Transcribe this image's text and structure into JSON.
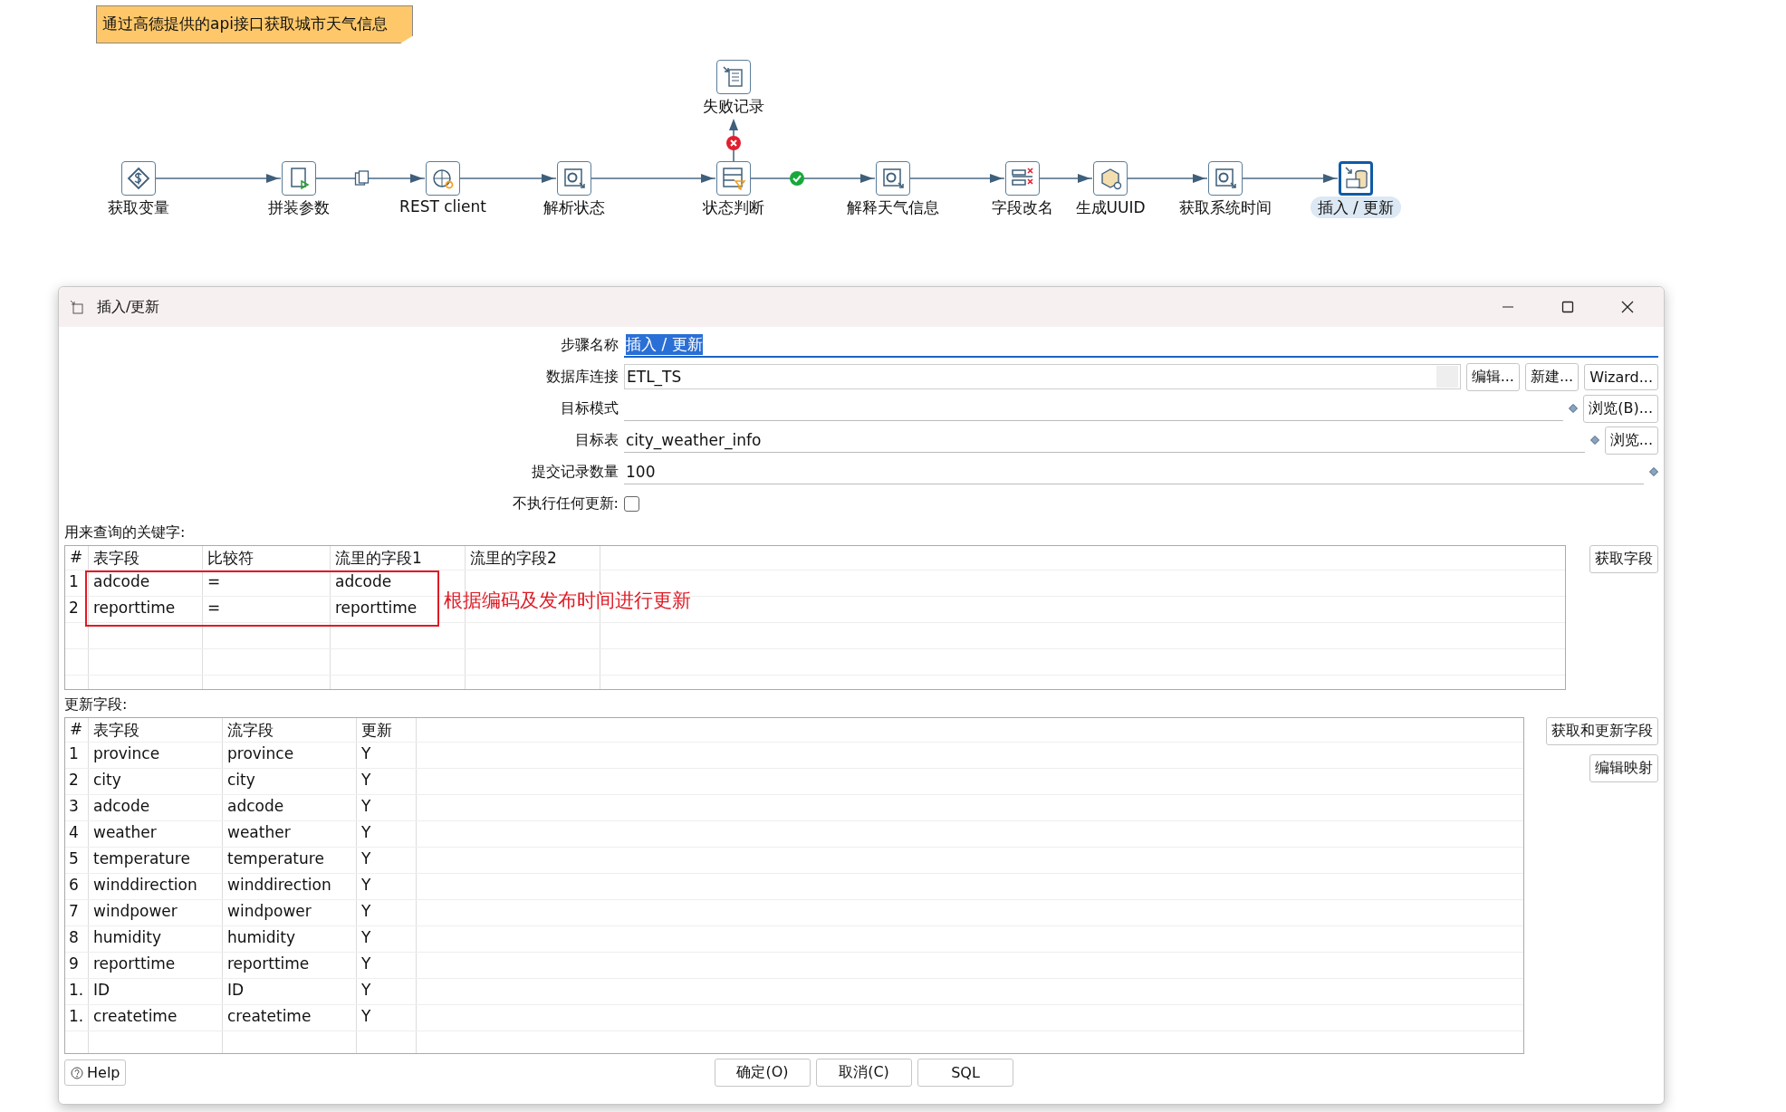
{
  "canvas": {
    "note": "通过高德提供的api接口获取城市天气信息",
    "steps": [
      {
        "label": "获取变量",
        "kind": "variables",
        "selected": false
      },
      {
        "label": "拼装参数",
        "kind": "script",
        "selected": false
      },
      {
        "label": "REST client",
        "kind": "rest",
        "selected": false
      },
      {
        "label": "解析状态",
        "kind": "json",
        "selected": false
      },
      {
        "label": "状态判断",
        "kind": "filter",
        "selected": false
      },
      {
        "label": "解释天气信息",
        "kind": "json",
        "selected": false
      },
      {
        "label": "字段改名",
        "kind": "rename",
        "selected": false
      },
      {
        "label": "生成UUID",
        "kind": "uuid",
        "selected": false
      },
      {
        "label": "获取系统时间",
        "kind": "systime",
        "selected": false
      },
      {
        "label": "插入 / 更新",
        "kind": "insert",
        "selected": true
      }
    ],
    "hops": [
      {
        "kind": "normal"
      },
      {
        "kind": "copy"
      },
      {
        "kind": "normal"
      },
      {
        "kind": "normal"
      },
      {
        "kind": "ok"
      },
      {
        "kind": "normal"
      },
      {
        "kind": "normal"
      },
      {
        "kind": "normal"
      },
      {
        "kind": "normal"
      }
    ],
    "branch": {
      "label": "失败记录",
      "kind": "output",
      "hop": {
        "kind": "error"
      }
    }
  },
  "dialog": {
    "title": "插入/更新",
    "form": [
      {
        "label": "步骤名称",
        "kind": "text",
        "value": "插入 / 更新",
        "highlighted": true
      },
      {
        "label": "数据库连接",
        "kind": "combo",
        "value": "ETL_TS",
        "buttons": [
          "编辑...",
          "新建...",
          "Wizard..."
        ]
      },
      {
        "label": "目标模式",
        "kind": "text",
        "variable": true,
        "buttons": [
          "浏览(B)..."
        ]
      },
      {
        "label": "目标表",
        "kind": "text",
        "value": "city_weather_info",
        "variable": true,
        "buttons": [
          "浏览..."
        ]
      },
      {
        "label": "提交记录数量",
        "kind": "text",
        "value": "100",
        "variable": true
      },
      {
        "label": "不执行任何更新:",
        "kind": "checkbox",
        "checked": false
      }
    ],
    "keys": {
      "title": "用来查询的关键字:",
      "columns": [
        "#",
        "表字段",
        "比较符",
        "流里的字段1",
        "流里的字段2"
      ],
      "rows": [
        [
          "1",
          "adcode",
          "=",
          "adcode"
        ],
        [
          "2",
          "reporttime",
          "=",
          "reporttime"
        ]
      ],
      "button": "获取字段",
      "annotation": "根据编码及发布时间进行更新"
    },
    "updates": {
      "title": "更新字段:",
      "columns": [
        "#",
        "表字段",
        "流字段",
        "更新"
      ],
      "rows": [
        [
          "1",
          "province",
          "province",
          "Y"
        ],
        [
          "2",
          "city",
          "city",
          "Y"
        ],
        [
          "3",
          "adcode",
          "adcode",
          "Y"
        ],
        [
          "4",
          "weather",
          "weather",
          "Y"
        ],
        [
          "5",
          "temperature",
          "temperature",
          "Y"
        ],
        [
          "6",
          "winddirection",
          "winddirection",
          "Y"
        ],
        [
          "7",
          "windpower",
          "windpower",
          "Y"
        ],
        [
          "8",
          "humidity",
          "humidity",
          "Y"
        ],
        [
          "9",
          "reporttime",
          "reporttime",
          "Y"
        ],
        [
          "1.",
          "ID",
          "ID",
          "Y"
        ],
        [
          "1.",
          "createtime",
          "createtime",
          "Y"
        ]
      ],
      "buttons": [
        "获取和更新字段",
        "编辑映射"
      ]
    },
    "footer": {
      "help": "Help",
      "buttons": [
        "确定(O)",
        "取消(C)",
        "SQL"
      ]
    }
  }
}
